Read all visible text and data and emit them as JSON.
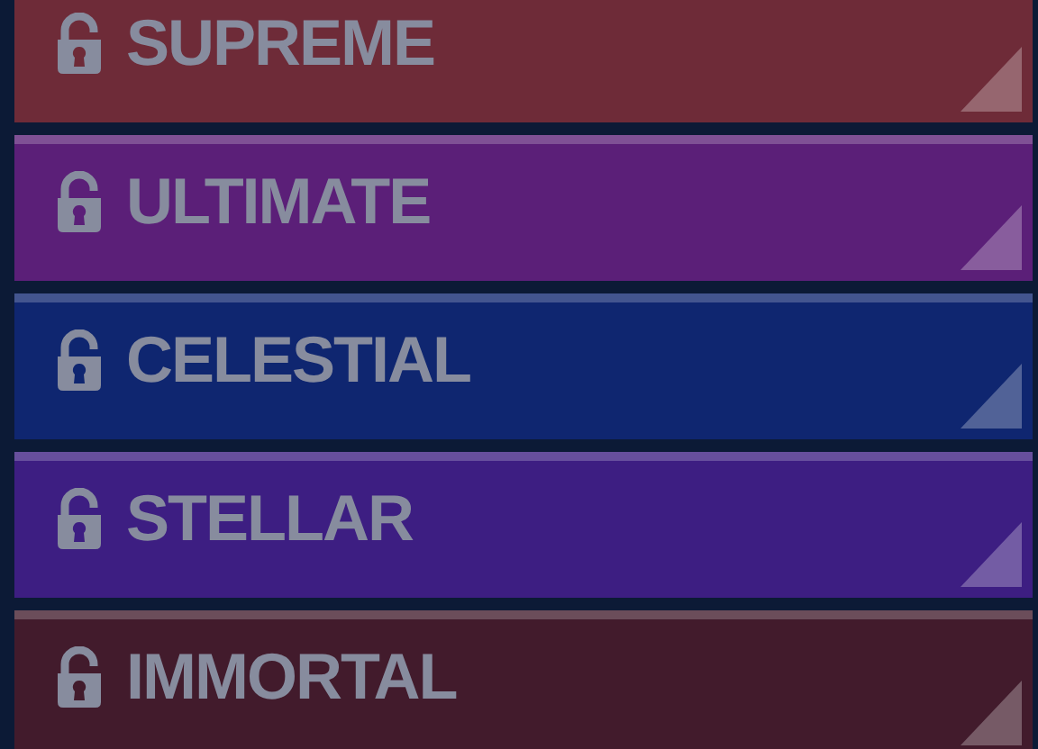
{
  "tiers": [
    {
      "name": "SUPREME",
      "color": "#6e2b38",
      "locked": false
    },
    {
      "name": "ULTIMATE",
      "color": "#5b1f78",
      "locked": false
    },
    {
      "name": "CELESTIAL",
      "color": "#0f2670",
      "locked": false
    },
    {
      "name": "STELLAR",
      "color": "#3d1e82",
      "locked": false
    },
    {
      "name": "IMMORTAL",
      "color": "#421b2c",
      "locked": false
    }
  ]
}
